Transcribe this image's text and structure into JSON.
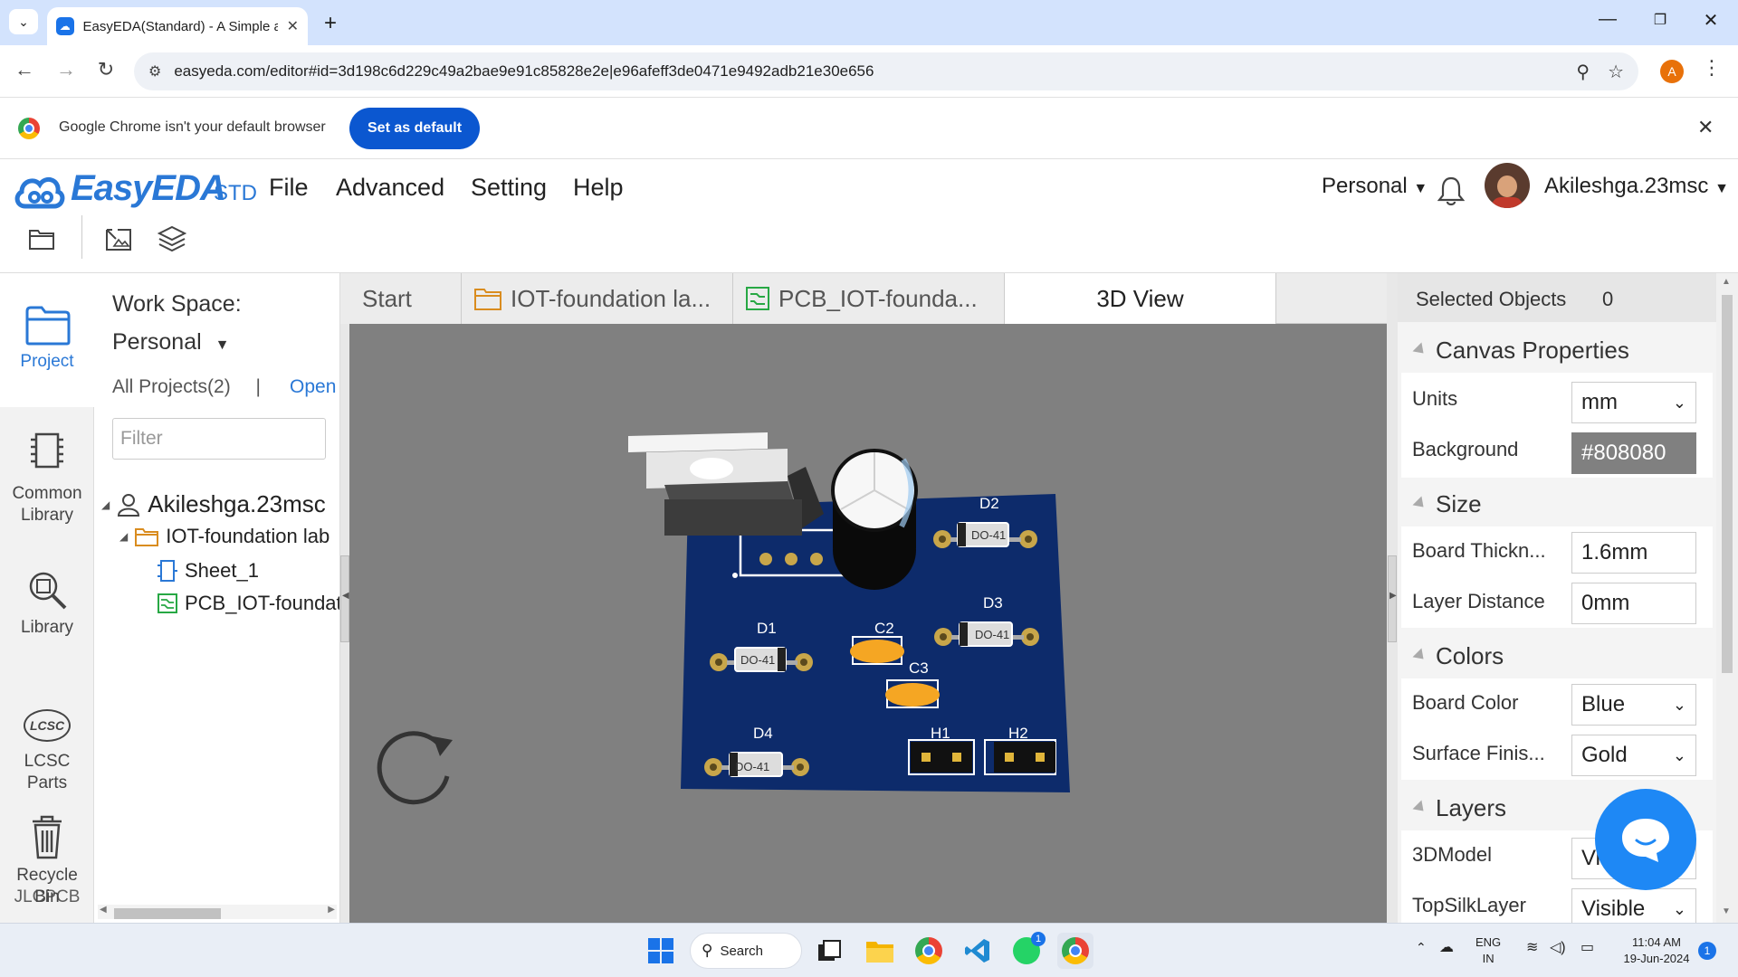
{
  "browser": {
    "tab_title": "EasyEDA(Standard) - A Simple and Powerful",
    "url": "easyeda.com/editor#id=3d198c6d229c49a2bae9e91c85828e2e|e96afeff3de0471e9492adb21e30e656",
    "profile_initial": "A"
  },
  "infobar": {
    "message": "Google Chrome isn't your default browser",
    "set_default_label": "Set as default"
  },
  "app": {
    "logo": "EasyEDA",
    "edition": "STD",
    "menu": [
      "File",
      "Advanced",
      "Setting",
      "Help"
    ],
    "workspace_selector": "Personal",
    "username": "Akileshga.23msc"
  },
  "left_rail": {
    "project": "Project",
    "common_library": [
      "Common",
      "Library"
    ],
    "library": "Library",
    "lcsc": [
      "LCSC",
      "Parts"
    ],
    "recycle": [
      "Recycle",
      "Bin"
    ],
    "jlcpcb": "JLCPCB"
  },
  "project_panel": {
    "workspace_label": "Work Space:",
    "workspace_value": "Personal",
    "all_projects": "All Projects(2)",
    "separator": "|",
    "open_label": "Open",
    "filter_placeholder": "Filter",
    "tree": {
      "user": "Akileshga.23msc",
      "project": "IOT-foundation lab",
      "sheet": "Sheet_1",
      "pcb": "PCB_IOT-foundation lab"
    }
  },
  "tabs": {
    "start": "Start",
    "schematic": "IOT-foundation la...",
    "pcb": "PCB_IOT-founda...",
    "view3d": "3D View"
  },
  "board": {
    "labels": {
      "d1": "D1",
      "d2": "D2",
      "d3": "D3",
      "d4": "D4",
      "c2": "C2",
      "c3": "C3",
      "h1": "H1",
      "h2": "H2",
      "package": "DO-41"
    }
  },
  "properties": {
    "selected_label": "Selected Objects",
    "selected_count": "0",
    "canvas_section": "Canvas Properties",
    "units_label": "Units",
    "units_value": "mm",
    "background_label": "Background",
    "background_value": "#808080",
    "size_section": "Size",
    "board_thickness_label": "Board Thickn...",
    "board_thickness_value": "1.6mm",
    "layer_distance_label": "Layer Distance",
    "layer_distance_value": "0mm",
    "colors_section": "Colors",
    "board_color_label": "Board Color",
    "board_color_value": "Blue",
    "surface_finish_label": "Surface Finis...",
    "surface_finish_value": "Gold",
    "layers_section": "Layers",
    "model3d_label": "3DModel",
    "model3d_value": "Visible",
    "topsilk_label": "TopSilkLayer",
    "topsilk_value": "Visible"
  },
  "taskbar": {
    "search_label": "Search",
    "lang_top": "ENG",
    "lang_bottom": "IN",
    "time": "11:04 AM",
    "date": "19-Jun-2024",
    "whatsapp_badge": "1",
    "notification_count": "1"
  },
  "colors": {
    "canvas_background": "#808080",
    "board_blue": "#0d2b6b",
    "brand_blue": "#2a78d6"
  }
}
